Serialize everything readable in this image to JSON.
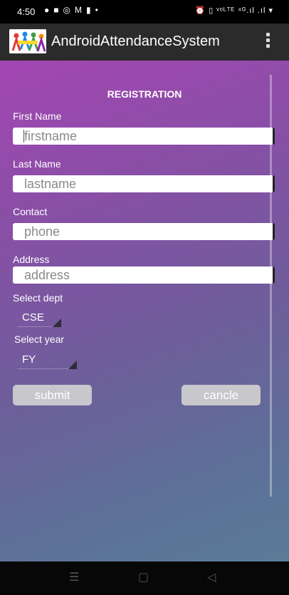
{
  "status_bar": {
    "time": "4:50",
    "left_icons": [
      "whatsapp-icon",
      "youtube-icon",
      "instagram-icon",
      "gmail-icon",
      "notification-icon",
      "dot-icon"
    ],
    "right_text": "⏰ ▯ ᵛᵒᴸᵀᴱ ⁴ᴳ.ıl .ıl ▾"
  },
  "app_bar": {
    "title": "AndroidAttendanceSystem",
    "menu_icon": "overflow-menu-icon"
  },
  "form": {
    "heading": "REGISTRATION",
    "first_name": {
      "label": "First Name",
      "placeholder": "firstname",
      "value": ""
    },
    "last_name": {
      "label": "Last Name",
      "placeholder": "lastname",
      "value": ""
    },
    "contact": {
      "label": "Contact",
      "placeholder": "phone",
      "value": ""
    },
    "address": {
      "label": "Address",
      "placeholder": "address",
      "value": ""
    },
    "dept": {
      "label": "Select dept",
      "selected": "CSE"
    },
    "year": {
      "label": "Select year",
      "selected": "FY"
    },
    "submit_label": "submit",
    "cancel_label": "cancle"
  },
  "nav_bar": {
    "icons": [
      "recents-icon",
      "home-icon",
      "back-icon"
    ]
  },
  "colors": {
    "gradient_top": "#a346b2",
    "gradient_bottom": "#5a7b98",
    "app_bar": "#2b2b2b",
    "button": "#c7c7cc"
  }
}
